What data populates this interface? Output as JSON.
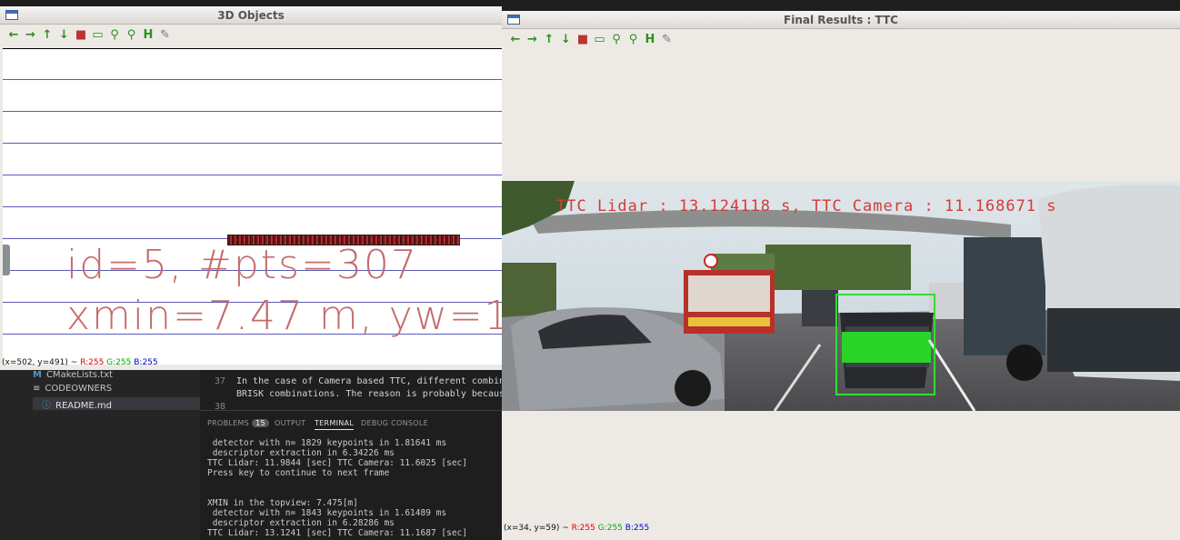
{
  "window_3d": {
    "title": "3D Objects",
    "label_line1": "id=5, #pts=307",
    "label_line2": "xmin=7.47 m, yw=1.",
    "status_pos": "(x=502, y=491) ~ ",
    "status_r": "R:255",
    "status_g": "G:255",
    "status_b": "B:255"
  },
  "window_ttc": {
    "title": "Final Results : TTC",
    "overlay_text": "TTC Lidar : 13.124118 s, TTC Camera : 11.168671 s",
    "status_pos": "(x=34, y=59) ~ ",
    "status_r": "R:255",
    "status_g": "G:255",
    "status_b": "B:255"
  },
  "toolbar_icons": [
    "arrow-left-icon",
    "arrow-right-icon",
    "arrow-up-icon",
    "arrow-down-icon",
    "save-image-icon",
    "properties-icon",
    "zoom-in-icon",
    "zoom-out-icon",
    "save-icon",
    "settings-icon"
  ],
  "explorer": {
    "files": [
      {
        "icon": "M",
        "name": "CMakeLists.txt"
      },
      {
        "icon": "≡",
        "name": "CODEOWNERS"
      },
      {
        "icon": "ⓘ",
        "name": "README.md"
      }
    ]
  },
  "editor": {
    "lines": [
      {
        "num": "37",
        "text": "In the case of Camera based TTC, different combin"
      },
      {
        "num": "",
        "text": "BRISK combinations. The reason is probably becaus"
      },
      {
        "num": "38",
        "text": ""
      }
    ]
  },
  "panel": {
    "tabs": [
      "PROBLEMS",
      "OUTPUT",
      "TERMINAL",
      "DEBUG CONSOLE"
    ],
    "problems_count": "15",
    "terminal_lines": [
      " detector with n= 1829 keypoints in 1.81641 ms",
      " descriptor extraction in 6.34226 ms",
      "TTC Lidar: 11.9844 [sec] TTC Camera: 11.6025 [sec]",
      "Press key to continue to next frame",
      "",
      "",
      "XMIN in the topview: 7.475[m]",
      " detector with n= 1843 keypoints in 1.61489 ms",
      " descriptor extraction in 6.28286 ms",
      "TTC Lidar: 13.1241 [sec] TTC Camera: 11.1687 [sec]"
    ]
  },
  "colors": {
    "toolbar_green": "#2f8f1e",
    "grid_blue": "#5b5bb8",
    "label_red": "#c46b6b",
    "bbox_green": "#33dd33"
  }
}
